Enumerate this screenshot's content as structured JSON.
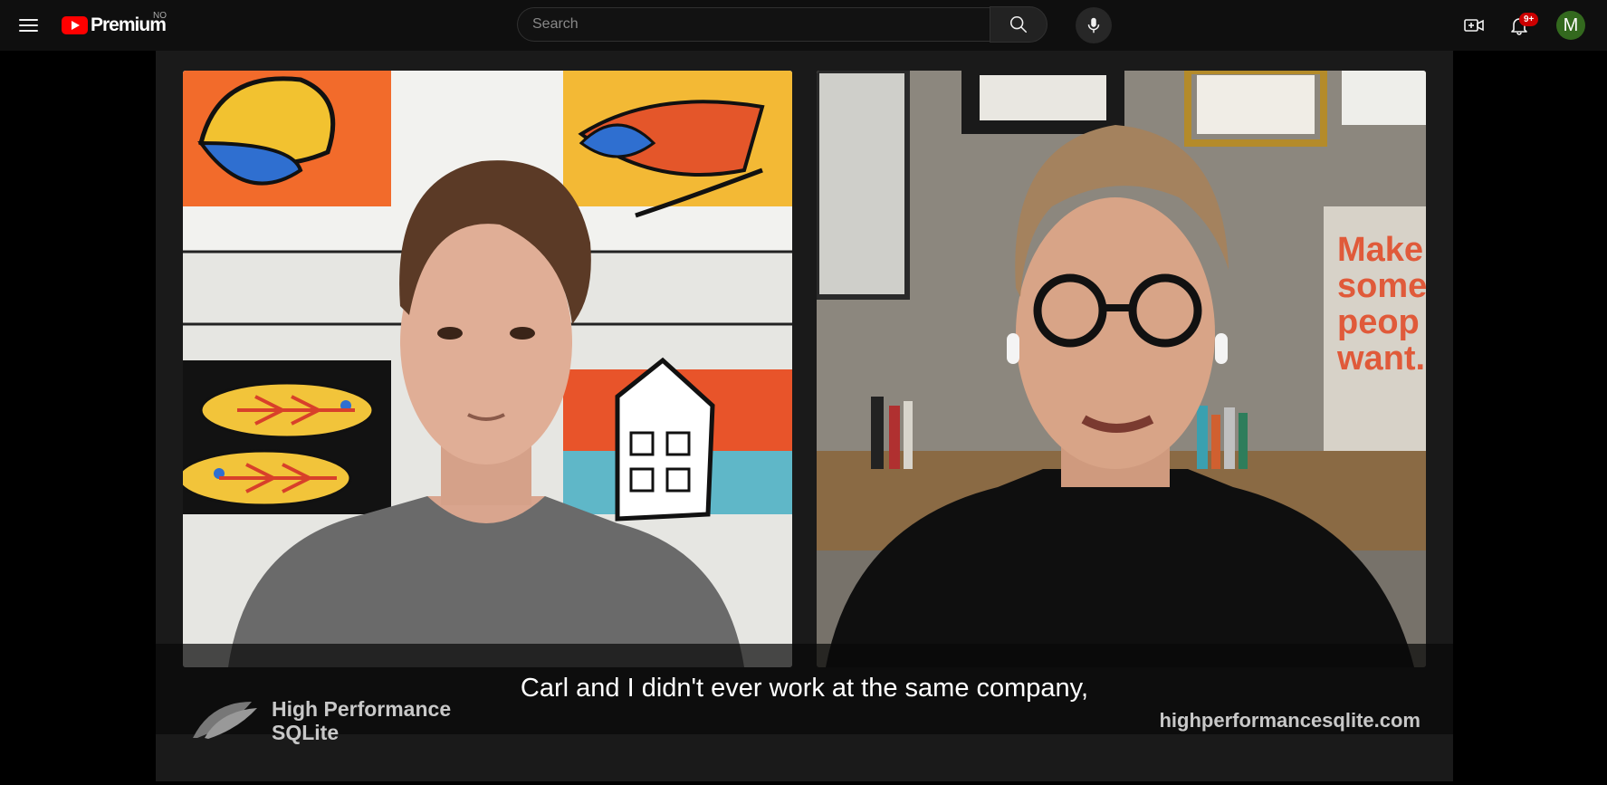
{
  "topbar": {
    "logo_text": "Premium",
    "country_code": "NO",
    "search_placeholder": "Search",
    "notification_count": "9+",
    "avatar_initial": "M"
  },
  "video": {
    "caption": "Carl and I didn't ever work at the same company,",
    "brand_name": "High Performance\nSQLite",
    "brand_url": "highperformancesqlite.com",
    "poster_text_right": "Make something people want."
  }
}
